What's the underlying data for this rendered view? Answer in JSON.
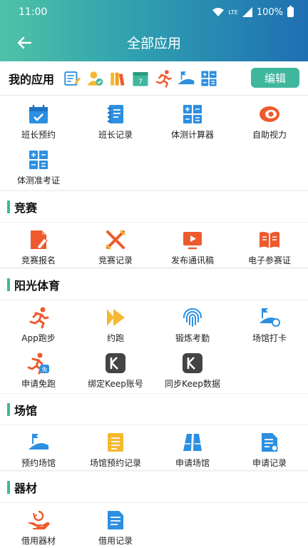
{
  "status": {
    "time": "11:00",
    "network": "LTE",
    "battery": "100%"
  },
  "header": {
    "title": "全部应用"
  },
  "my_apps": {
    "title": "我的应用",
    "edit_label": "编辑",
    "icons": [
      "form-edit-icon",
      "user-check-icon",
      "books-icon",
      "calendar-icon",
      "runner-icon",
      "stadium-icon",
      "calculator-icon"
    ],
    "calendar_day": "7"
  },
  "top_apps": [
    {
      "label": "班长预约",
      "icon": "calendar-check-icon"
    },
    {
      "label": "班长记录",
      "icon": "notebook-icon"
    },
    {
      "label": "体测计算器",
      "icon": "calculator-icon"
    },
    {
      "label": "自助视力",
      "icon": "eye-icon"
    },
    {
      "label": "体测准考证",
      "icon": "calculator-icon"
    }
  ],
  "sections": {
    "competition": {
      "title": "竞赛",
      "items": [
        {
          "label": "竞赛报名",
          "icon": "edit-doc-icon"
        },
        {
          "label": "竞赛记录",
          "icon": "crossed-swords-icon"
        },
        {
          "label": "发布通讯稿",
          "icon": "tv-play-icon"
        },
        {
          "label": "电子参赛证",
          "icon": "open-book-icon"
        }
      ]
    },
    "sunshine": {
      "title": "阳光体育",
      "items": [
        {
          "label": "App跑步",
          "icon": "runner-icon"
        },
        {
          "label": "约跑",
          "icon": "play-icon"
        },
        {
          "label": "锻炼考勤",
          "icon": "fingerprint-icon"
        },
        {
          "label": "场馆打卡",
          "icon": "stadium-check-icon"
        },
        {
          "label": "申请免跑",
          "icon": "runner-exempt-icon",
          "badge": "免"
        },
        {
          "label": "绑定Keep账号",
          "icon": "keep-icon"
        },
        {
          "label": "同步Keep数据",
          "icon": "keep-icon"
        }
      ]
    },
    "venue": {
      "title": "场馆",
      "items": [
        {
          "label": "预约场馆",
          "icon": "stadium-icon"
        },
        {
          "label": "场馆预约记录",
          "icon": "list-doc-icon"
        },
        {
          "label": "申请场馆",
          "icon": "building-icon"
        },
        {
          "label": "申请记录",
          "icon": "doc-check-icon"
        }
      ]
    },
    "equipment": {
      "title": "器材",
      "items": [
        {
          "label": "借用器材",
          "icon": "hand-return-icon"
        },
        {
          "label": "借用记录",
          "icon": "doc-lines-icon"
        }
      ]
    }
  },
  "colors": {
    "accent": "#3fb79d",
    "orange": "#ee5a2e",
    "blue": "#2d8fe0",
    "yellow": "#f5b82e"
  }
}
